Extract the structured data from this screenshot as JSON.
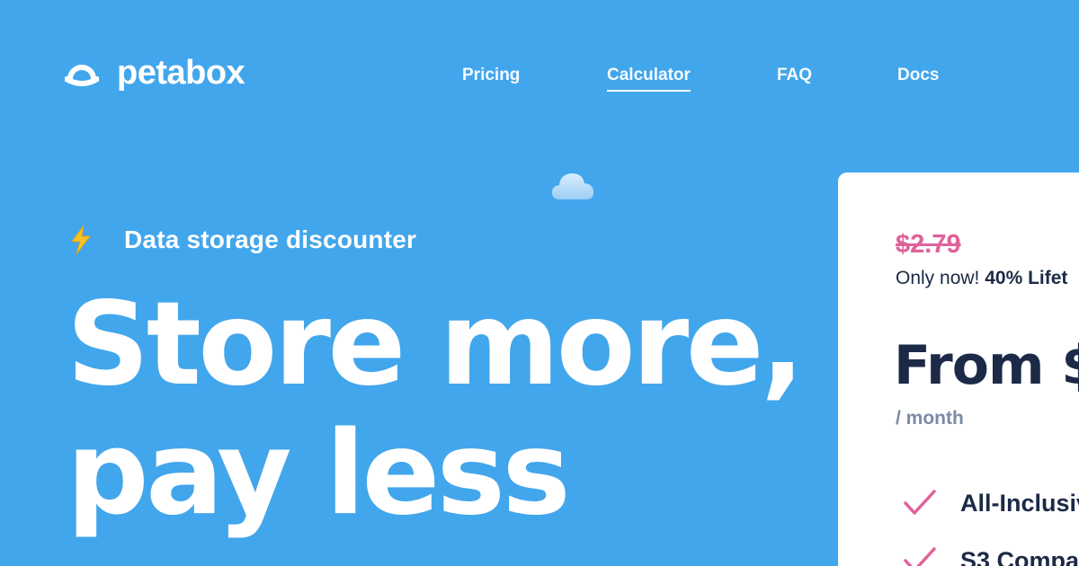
{
  "header": {
    "brand": "petabox",
    "logo_icon": "cloud-logo-icon",
    "nav": [
      {
        "label": "Pricing",
        "active": false
      },
      {
        "label": "Calculator",
        "active": true
      },
      {
        "label": "FAQ",
        "active": false
      },
      {
        "label": "Docs",
        "active": false
      }
    ]
  },
  "hero": {
    "tagline_icon": "lightning-bolt-icon",
    "tagline": "Data storage discounter",
    "headline_line1": "Store more,",
    "headline_line2": "pay less",
    "decor_icon": "cloud-icon"
  },
  "price_card": {
    "old_price": "$2.79",
    "promo_prefix": "Only now!",
    "promo_highlight": "40% Lifet",
    "from_price": "From $",
    "period": "/ month",
    "features": [
      {
        "label": "All-Inclusiv",
        "icon": "check-icon"
      },
      {
        "label": "S3 Compa",
        "icon": "check-icon"
      }
    ]
  },
  "colors": {
    "background": "#42a6ec",
    "card": "#ffffff",
    "accent_pink": "#e0629a",
    "dark_text": "#1c2a47",
    "muted_text": "#7d89a7",
    "bolt": "#f8c228"
  }
}
